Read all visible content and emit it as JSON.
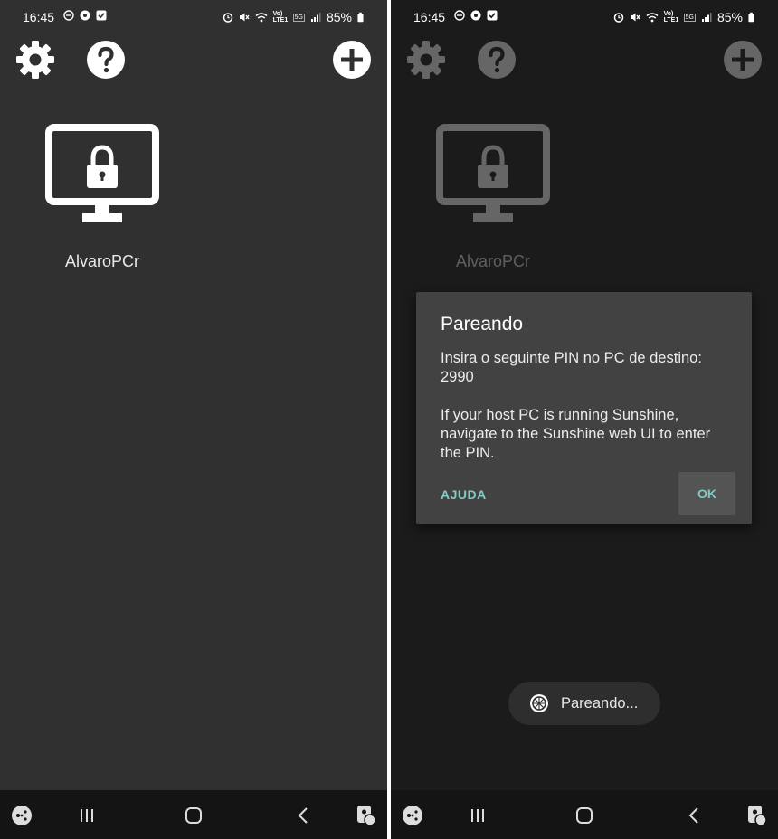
{
  "status_bar": {
    "time": "16:45",
    "battery": "85%",
    "network_labels": [
      "Vo) LTE1",
      "5G"
    ]
  },
  "toolbar": {
    "settings_icon": "gear-icon",
    "help_icon": "question-mark-icon",
    "add_icon": "plus-icon"
  },
  "computers": [
    {
      "name": "AlvaroPCr",
      "state": "locked",
      "icon": "locked-monitor-icon"
    }
  ],
  "dialog": {
    "title": "Pareando",
    "message_line1": "Insira o seguinte PIN no PC de destino:",
    "pin": "2990",
    "message_line2": "If your host PC is running Sunshine, navigate to the Sunshine web UI to enter the PIN.",
    "neutral_button": "AJUDA",
    "positive_button": "OK"
  },
  "toast": {
    "text": "Pareando...",
    "icon": "moonlight-logo-icon"
  },
  "nav_bar": {
    "buttons": [
      "gamepad-icon",
      "recents-icon",
      "home-icon",
      "back-icon",
      "accessibility-icon"
    ]
  },
  "colors": {
    "background_left": "#303030",
    "background_dimmed": "#1b1b1b",
    "dialog_background": "#424242",
    "accent": "#80cbc4"
  }
}
